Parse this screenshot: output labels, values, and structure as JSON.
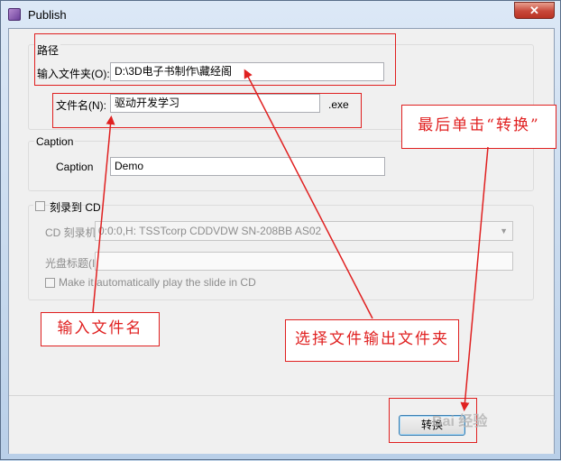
{
  "window": {
    "title": "Publish",
    "close_glyph": "✕",
    "icon": "app-icon"
  },
  "path_group": {
    "title": "路径",
    "folder_label": "输入文件夹(O):",
    "folder_value": "D:\\3D电子书制作\\藏经阁",
    "filename_label": "文件名(N):",
    "filename_value": "驱动开发学习",
    "extension": ".exe"
  },
  "caption_group": {
    "title": "Caption",
    "label": "Caption",
    "value": "Demo"
  },
  "cd_group": {
    "checkbox_label": "刻录到 CD",
    "burner_label": "CD 刻录机",
    "burner_value": "0:0:0,H: TSSTcorp CDDVDW SN-208BB  AS02",
    "disc_title_label": "光盘标题(I)",
    "disc_title_value": "",
    "autoplay_label": "Make it automatically play the  slide in CD"
  },
  "footer": {
    "convert_button": "转换"
  },
  "annotations": {
    "enter_filename": "输入文件名",
    "choose_folder": "选择文件输出文件夹",
    "click_convert": "最后单击“转换”",
    "color": "#e02020"
  },
  "watermark": "Bai 经验"
}
